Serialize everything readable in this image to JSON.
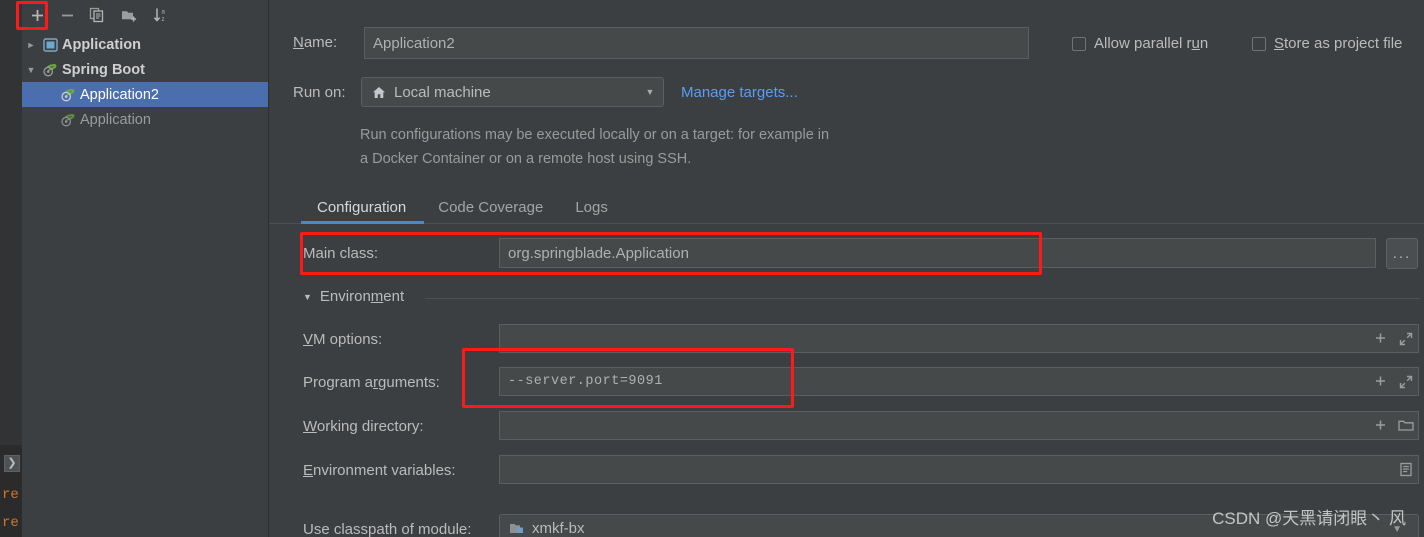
{
  "left_panel": {
    "toolbar": [
      {
        "name": "add",
        "icon": "plus-icon",
        "tooltip": "Add New Configuration"
      },
      {
        "name": "remove",
        "icon": "minus-icon",
        "tooltip": "Remove Configuration"
      },
      {
        "name": "copy",
        "icon": "copy-icon",
        "tooltip": "Copy Configuration"
      },
      {
        "name": "new-folder",
        "icon": "new-folder-icon",
        "tooltip": "Create New Folder"
      },
      {
        "name": "sort",
        "icon": "sort-alphabetical-icon",
        "tooltip": "Sort Configurations"
      }
    ],
    "tree": [
      {
        "label": "Application",
        "icon": "application-icon",
        "expanded": false,
        "twisty": "›",
        "level": 0,
        "bold": true,
        "selected": false
      },
      {
        "label": "Spring Boot",
        "icon": "spring-boot-icon",
        "expanded": true,
        "twisty": "⌄",
        "level": 0,
        "bold": true,
        "selected": false
      },
      {
        "label": "Application2",
        "icon": "spring-boot-icon",
        "level": 1,
        "bold": false,
        "selected": true
      },
      {
        "label": "Application",
        "icon": "spring-boot-icon",
        "level": 1,
        "bold": false,
        "selected": false
      }
    ]
  },
  "form": {
    "name_label": "Name:",
    "name_label_mnemonic": "N",
    "name_value": "Application2",
    "run_on_label": "Run on:",
    "run_on_value": "Local machine",
    "run_on_icon": "home-icon",
    "manage_targets_link": "Manage targets...",
    "description": "Run configurations may be executed locally or on a target: for example in a Docker Container or on a remote host using SSH.",
    "checkboxes": [
      {
        "label": "Allow parallel run",
        "mnemonic": "u",
        "checked": false
      },
      {
        "label": "Store as project file",
        "mnemonic": "S",
        "checked": false
      }
    ]
  },
  "tabs": [
    {
      "label": "Configuration",
      "active": true
    },
    {
      "label": "Code Coverage",
      "active": false
    },
    {
      "label": "Logs",
      "active": false
    }
  ],
  "configuration": {
    "main_class_label": "Main class:",
    "main_class_value": "org.springblade.Application",
    "main_class_browse": "...",
    "environment_section": "Environment",
    "environment_mnemonic": "m",
    "fields": [
      {
        "label": "VM options:",
        "mnemonic": "V",
        "value": "",
        "mono": false,
        "buttons": [
          "plus-icon",
          "expand-diagonal-icon"
        ]
      },
      {
        "label": "Program arguments:",
        "mnemonic": "r",
        "value": "--server.port=9091",
        "mono": true,
        "buttons": [
          "plus-icon",
          "expand-diagonal-icon"
        ]
      },
      {
        "label": "Working directory:",
        "mnemonic": "W",
        "value": "",
        "mono": false,
        "buttons": [
          "plus-icon",
          "folder-icon"
        ]
      },
      {
        "label": "Environment variables:",
        "mnemonic": "E",
        "value": "",
        "mono": false,
        "buttons": [
          "list-icon"
        ]
      }
    ],
    "module_label": "Use classpath of module:",
    "module_value": "xmkf-bx",
    "module_icon": "module-folder-icon"
  },
  "annotations": [
    {
      "name": "add-config-button",
      "target": "toolbar-add"
    },
    {
      "name": "main-class-row",
      "target": "main-class"
    },
    {
      "name": "program-arguments-row",
      "target": "program-arguments"
    }
  ],
  "watermark": "CSDN @天黑请闭眼丶 风",
  "editor_background": {
    "line1": "re",
    "line2": "re",
    "gutter_glyph": "❯"
  },
  "colors": {
    "window_bg": "#3c3f41",
    "panel_bg": "#3c3f41",
    "editor_bg": "#2b2b2b",
    "selection_blue": "#4b6eaf",
    "link_blue": "#589df6",
    "tab_underline": "#4a88c7",
    "field_bg": "#45494a",
    "field_border": "#5a5e60",
    "text": "#bbbbbb",
    "annotation_red": "#ff1a1a"
  }
}
